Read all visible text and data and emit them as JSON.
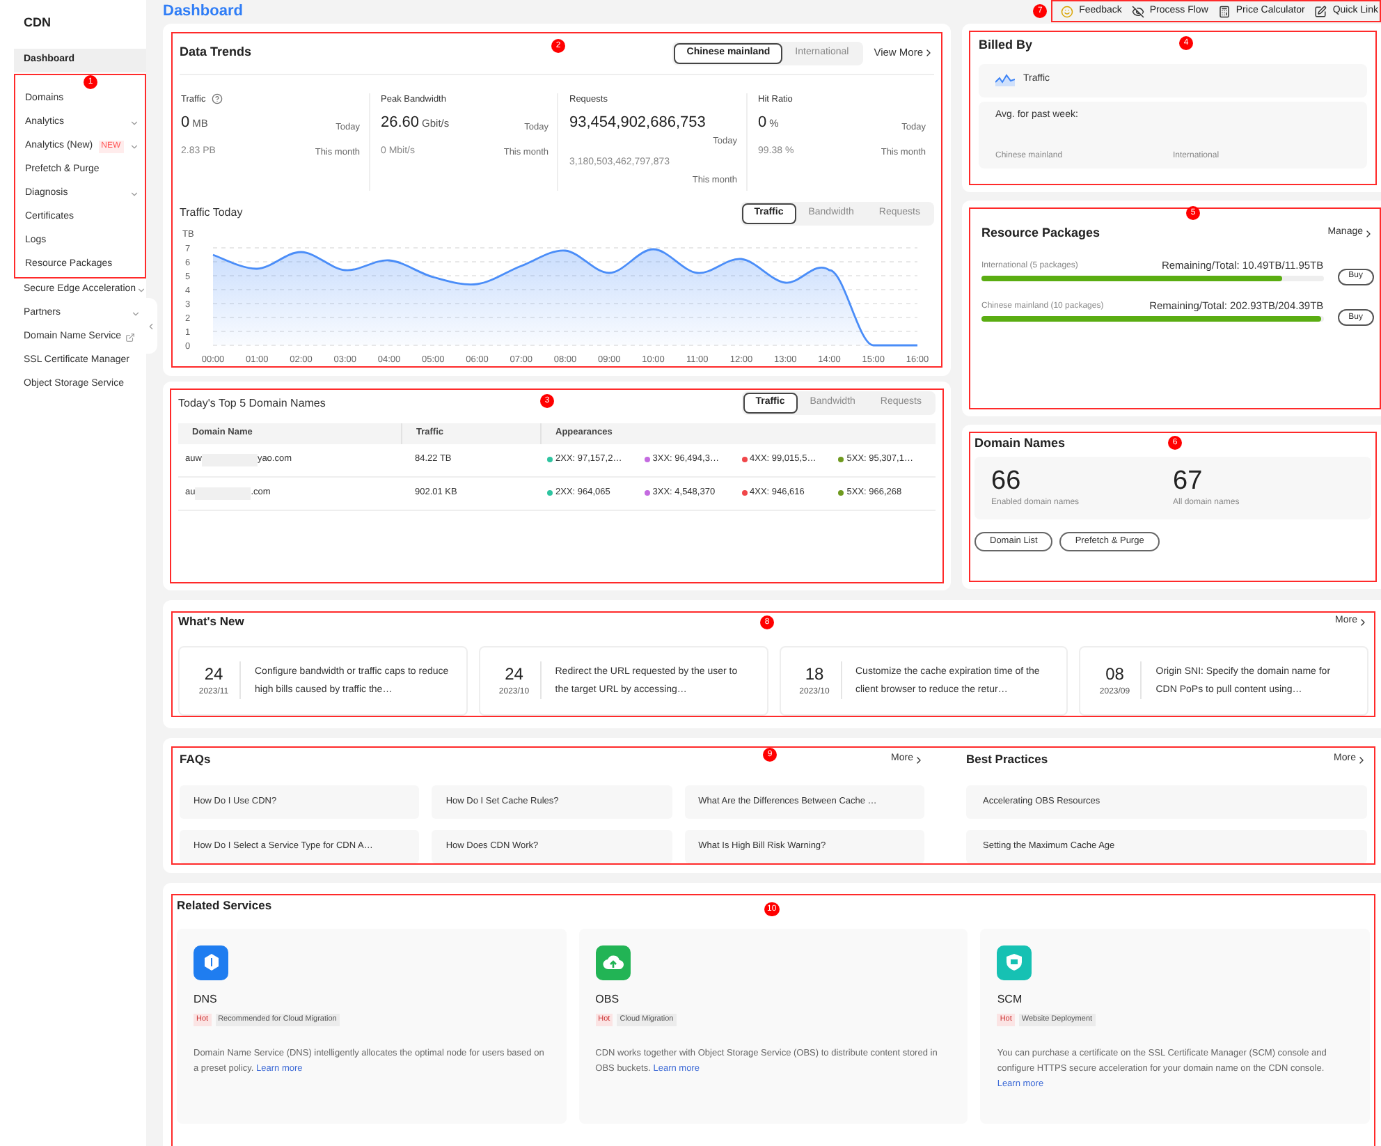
{
  "sidebar": {
    "title": "CDN",
    "top_items": [
      {
        "label": "Dashboard",
        "selected": true,
        "expandable": false
      }
    ],
    "callout": "1",
    "cdn_items": [
      {
        "label": "Domains",
        "selected": false,
        "expandable": false
      },
      {
        "label": "Analytics",
        "selected": false,
        "expandable": true
      },
      {
        "label": "Analytics (New)",
        "badge": "NEW",
        "selected": false,
        "expandable": true
      },
      {
        "label": "Prefetch & Purge",
        "selected": false,
        "expandable": false
      },
      {
        "label": "Diagnosis",
        "selected": false,
        "expandable": true
      },
      {
        "label": "Certificates",
        "selected": false,
        "expandable": false
      },
      {
        "label": "Logs",
        "selected": false,
        "expandable": false
      },
      {
        "label": "Resource Packages",
        "selected": false,
        "expandable": false
      }
    ],
    "more_items": [
      {
        "label": "Secure Edge Acceleration",
        "selected": false,
        "expandable": true
      },
      {
        "label": "Partners",
        "selected": false,
        "expandable": true
      },
      {
        "label": "Domain Name Service",
        "selected": false,
        "expandable": false,
        "external": true
      },
      {
        "label": "SSL Certificate Manager",
        "selected": false,
        "expandable": false
      },
      {
        "label": "Object Storage Service",
        "selected": false,
        "expandable": false
      }
    ]
  },
  "page_title": "Dashboard",
  "header_links": {
    "callout": "7",
    "items": [
      {
        "kind": "feedback",
        "label": "Feedback"
      },
      {
        "kind": "flow",
        "label": "Process Flow"
      },
      {
        "kind": "calculator",
        "label": "Price Calculator"
      },
      {
        "kind": "links",
        "label": "Quick Link"
      }
    ]
  },
  "data_trends": {
    "callout": "2",
    "title": "Data Trends",
    "regions": [
      {
        "label": "Chinese mainland",
        "selected": true
      },
      {
        "label": "International",
        "selected": false
      }
    ],
    "view_more": "View More",
    "metrics": [
      {
        "name": "Traffic",
        "help": true,
        "value": "0",
        "unit": "MB",
        "today": "Today",
        "month_value": "2.83 PB",
        "month": "This month"
      },
      {
        "name": "Peak Bandwidth",
        "help": false,
        "value": "26.60",
        "unit": "Gbit/s",
        "today": "Today",
        "month_value": "0 Mbit/s",
        "month": "This month"
      },
      {
        "name": "Requests",
        "help": false,
        "value": "93,454,902,686,753",
        "today": "Today",
        "month_value": "3,180,503,462,797,873",
        "month": "This month"
      },
      {
        "name": "Hit Ratio",
        "help": false,
        "value": "0",
        "unit": "%",
        "today": "Today",
        "month_value": "99.38 %",
        "month": "This month"
      }
    ],
    "chart_title": "Traffic Today",
    "chart_tabs": [
      {
        "label": "Traffic",
        "selected": true
      },
      {
        "label": "Bandwidth",
        "selected": false
      },
      {
        "label": "Requests",
        "selected": false
      }
    ],
    "chart_data": {
      "type": "area",
      "grid": true,
      "ylabel": "TB",
      "categories": [
        "00:00",
        "01:00",
        "02:00",
        "03:00",
        "04:00",
        "05:00",
        "06:00",
        "07:00",
        "08:00",
        "09:00",
        "10:00",
        "11:00",
        "12:00",
        "13:00",
        "14:00",
        "15:00",
        "16:00"
      ],
      "series": [
        {
          "color": "#4a8df8",
          "values": [
            6.5,
            5.5,
            6.7,
            5.4,
            6.1,
            4.9,
            4.4,
            5.7,
            6.8,
            5.2,
            6.9,
            5.2,
            6.2,
            4.5,
            5.4,
            0,
            0
          ]
        }
      ],
      "ylim": [
        0,
        7
      ],
      "yticks": [
        0,
        1,
        2,
        3,
        4,
        5,
        6,
        7
      ]
    }
  },
  "top_domains": {
    "callout": "3",
    "title": "Today's Top 5 Domain Names",
    "tabs": [
      {
        "label": "Traffic",
        "selected": true
      },
      {
        "label": "Bandwidth",
        "selected": false
      },
      {
        "label": "Requests",
        "selected": false
      }
    ],
    "columns": [
      "Domain Name",
      "Traffic",
      "Appearances"
    ],
    "rows": [
      {
        "domain_start": "auw",
        "domain_end": "yao.com",
        "redacted": true,
        "traffic": "84.22 TB",
        "codes": [
          {
            "label": "2XX: 97,157,2…",
            "color": "#2ec4a0"
          },
          {
            "label": "3XX: 96,494,3…",
            "color": "#c46be0"
          },
          {
            "label": "4XX: 99,015,5…",
            "color": "#f0474a"
          },
          {
            "label": "5XX: 95,307,1…",
            "color": "#6f9a1f"
          }
        ]
      },
      {
        "domain_start": "au",
        "domain_end": ".com",
        "redacted": true,
        "traffic": "902.01 KB",
        "codes": [
          {
            "label": "2XX: 964,065",
            "color": "#2ec4a0"
          },
          {
            "label": "3XX: 4,548,370",
            "color": "#c46be0"
          },
          {
            "label": "4XX: 946,616",
            "color": "#f0474a"
          },
          {
            "label": "5XX: 966,268",
            "color": "#6f9a1f"
          }
        ]
      }
    ]
  },
  "billed_by": {
    "callout": "4",
    "title": "Billed By",
    "mode": "Traffic",
    "avg_label": "Avg. for past week:",
    "regions": [
      "Chinese mainland",
      "International"
    ]
  },
  "resource_packages": {
    "callout": "5",
    "title": "Resource Packages",
    "manage": "Manage",
    "packages": [
      {
        "name": "International (5 packages)",
        "summary": "Remaining/Total: 10.49TB/11.95TB",
        "level": 0.878,
        "button": "Buy"
      },
      {
        "name": "Chinese mainland (10 packages)",
        "summary": "Remaining/Total: 202.93TB/204.39TB",
        "level": 0.993,
        "button": "Buy"
      }
    ]
  },
  "domain_names": {
    "callout": "6",
    "title": "Domain Names",
    "stats": [
      {
        "value": "66",
        "label": "Enabled domain names"
      },
      {
        "value": "67",
        "label": "All domain names"
      }
    ],
    "buttons": [
      "Domain List",
      "Prefetch & Purge"
    ]
  },
  "whats_new": {
    "callout": "8",
    "title": "What's New",
    "more": "More",
    "items": [
      {
        "day": "24",
        "month": "2023/11",
        "text": "Configure bandwidth or traffic caps to reduce high bills caused by traffic the…"
      },
      {
        "day": "24",
        "month": "2023/10",
        "text": "Redirect the URL requested by the user to the target URL by accessing…"
      },
      {
        "day": "18",
        "month": "2023/10",
        "text": "Customize the cache expiration time of the client browser to reduce the retur…"
      },
      {
        "day": "08",
        "month": "2023/09",
        "text": "Origin SNI: Specify the domain name for CDN PoPs to pull content using…"
      }
    ]
  },
  "help": {
    "callout": "9",
    "faqs": {
      "title": "FAQs",
      "more": "More",
      "items": [
        "How Do I Use CDN?",
        "How Do I Set Cache Rules?",
        "What Are the Differences Between Cache …",
        "How Do I Select a Service Type for CDN A…",
        "How Does CDN Work?",
        "What Is High Bill Risk Warning?"
      ]
    },
    "best_practices": {
      "title": "Best Practices",
      "more": "More",
      "items": [
        "Accelerating OBS Resources",
        "Setting the Maximum Cache Age"
      ]
    }
  },
  "related_services": {
    "callout": "10",
    "title": "Related Services",
    "services": [
      {
        "kind": "dns",
        "name": "DNS",
        "tags": [
          {
            "label": "Hot",
            "hot": true
          },
          {
            "label": "Recommended for Cloud Migration",
            "hot": false
          }
        ],
        "description": "Domain Name Service (DNS) intelligently allocates the optimal node for users based on a preset policy.",
        "link": "Learn more"
      },
      {
        "kind": "obs",
        "name": "OBS",
        "tags": [
          {
            "label": "Hot",
            "hot": true
          },
          {
            "label": "Cloud Migration",
            "hot": false
          }
        ],
        "description": "CDN works together with Object Storage Service (OBS) to distribute content stored in OBS buckets.",
        "link": "Learn more"
      },
      {
        "kind": "scm",
        "name": "SCM",
        "tags": [
          {
            "label": "Hot",
            "hot": true
          },
          {
            "label": "Website Deployment",
            "hot": false
          }
        ],
        "description": "You can purchase a certificate on the SSL Certificate Manager (SCM) console and configure HTTPS secure acceleration for your domain name on the CDN console.",
        "link": "Learn more"
      }
    ]
  }
}
